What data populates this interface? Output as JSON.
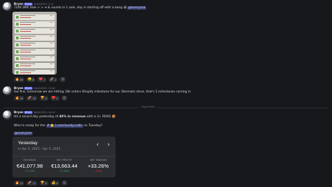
{
  "messages": [
    {
      "author": "Bryan",
      "badge": "ROAS",
      "timestamp": "01/04/2025, 7:14",
      "text_before": "7200 DKK Sale > > ➜ & counts in 1 sale, day is starting off with a bang",
      "emoji": "😁",
      "mention": "@everyone",
      "reactions": [
        {
          "emoji": "🔥",
          "count": "39"
        },
        {
          "emoji": "🤑",
          "count": "8"
        },
        {
          "emoji": "❤️",
          "count": "2"
        },
        {
          "emoji": "🚀",
          "count": "2"
        }
      ]
    },
    {
      "author": "Bryan",
      "badge": "ROAS",
      "timestamp": "01/04/2025, 13:40",
      "text": "Gw fine, tomorrow we are hitting 10k orders Shopify milestone for our Denmark store, that's 2 milestones coming in",
      "reactions": [
        {
          "emoji": "🔥",
          "count": "20"
        },
        {
          "emoji": "🚀",
          "count": "10"
        },
        {
          "emoji": "🏆",
          "count": "6"
        },
        {
          "emoji": "❤️",
          "count": "2"
        }
      ]
    },
    {
      "author": "Bryan",
      "badge": "ROAS",
      "timestamp": "08/04/2025, 10:24",
      "line1_before": "Hit a record day yesterday of",
      "line1_bold": "40% in revenue",
      "line1_after": "with a 3+ ROAS",
      "line1_emoji": "🥵",
      "line2_before": "Who're ready for the",
      "line2_channel": "# 🌟 | community-calls",
      "line2_after": "on Tuesday?",
      "mention": "@everyone",
      "reactions": [
        {
          "emoji": "🔥",
          "count": "21"
        },
        {
          "emoji": "🚀",
          "count": "11"
        },
        {
          "emoji": "🏆",
          "count": "6"
        },
        {
          "emoji": "💰",
          "count": "6"
        }
      ]
    }
  ],
  "date_divider": "7 April 2025",
  "stats_card": {
    "title": "Yesterday",
    "date_range": "in Apr 5, 2025 - Apr 5, 2025",
    "prev_label": "‹",
    "next_label": "›",
    "metrics": [
      {
        "label": "REVENUE",
        "value": "€41,077.98",
        "delta": "+5.19%",
        "delta_color": "#3ba55d"
      },
      {
        "label": "NET PROFIT",
        "value": "€13,663.44",
        "delta": "+3.48%",
        "delta_color": "#3ba55d"
      },
      {
        "label": "NET MARGIN",
        "value": "+33.26%",
        "delta": "-7.1%",
        "delta_color": "#ed4245"
      }
    ]
  },
  "colors": {
    "background": "#17181b",
    "mention_bg": "#3c4270",
    "accent": "#5865f2"
  }
}
